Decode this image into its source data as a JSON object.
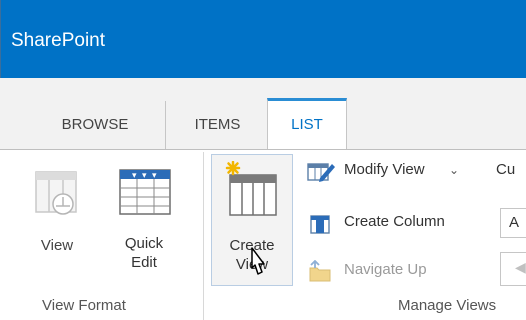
{
  "suite_bar": {
    "brand": "SharePoint"
  },
  "tabs": [
    {
      "label": "BROWSE"
    },
    {
      "label": "ITEMS"
    },
    {
      "label": "LIST"
    }
  ],
  "ribbon": {
    "view_format": {
      "view_label": "View",
      "quick_edit_line1": "Quick",
      "quick_edit_line2": "Edit",
      "group_label": "View Format"
    },
    "manage_views": {
      "create_view_line1": "Create",
      "create_view_line2": "View",
      "modify_view": "Modify View",
      "create_column": "Create Column",
      "navigate_up": "Navigate Up",
      "current_partial": "Cu",
      "field_partial": "A",
      "group_label": "Manage Views"
    }
  },
  "colors": {
    "accent": "#0072c6",
    "tab_active": "#0072c6"
  }
}
